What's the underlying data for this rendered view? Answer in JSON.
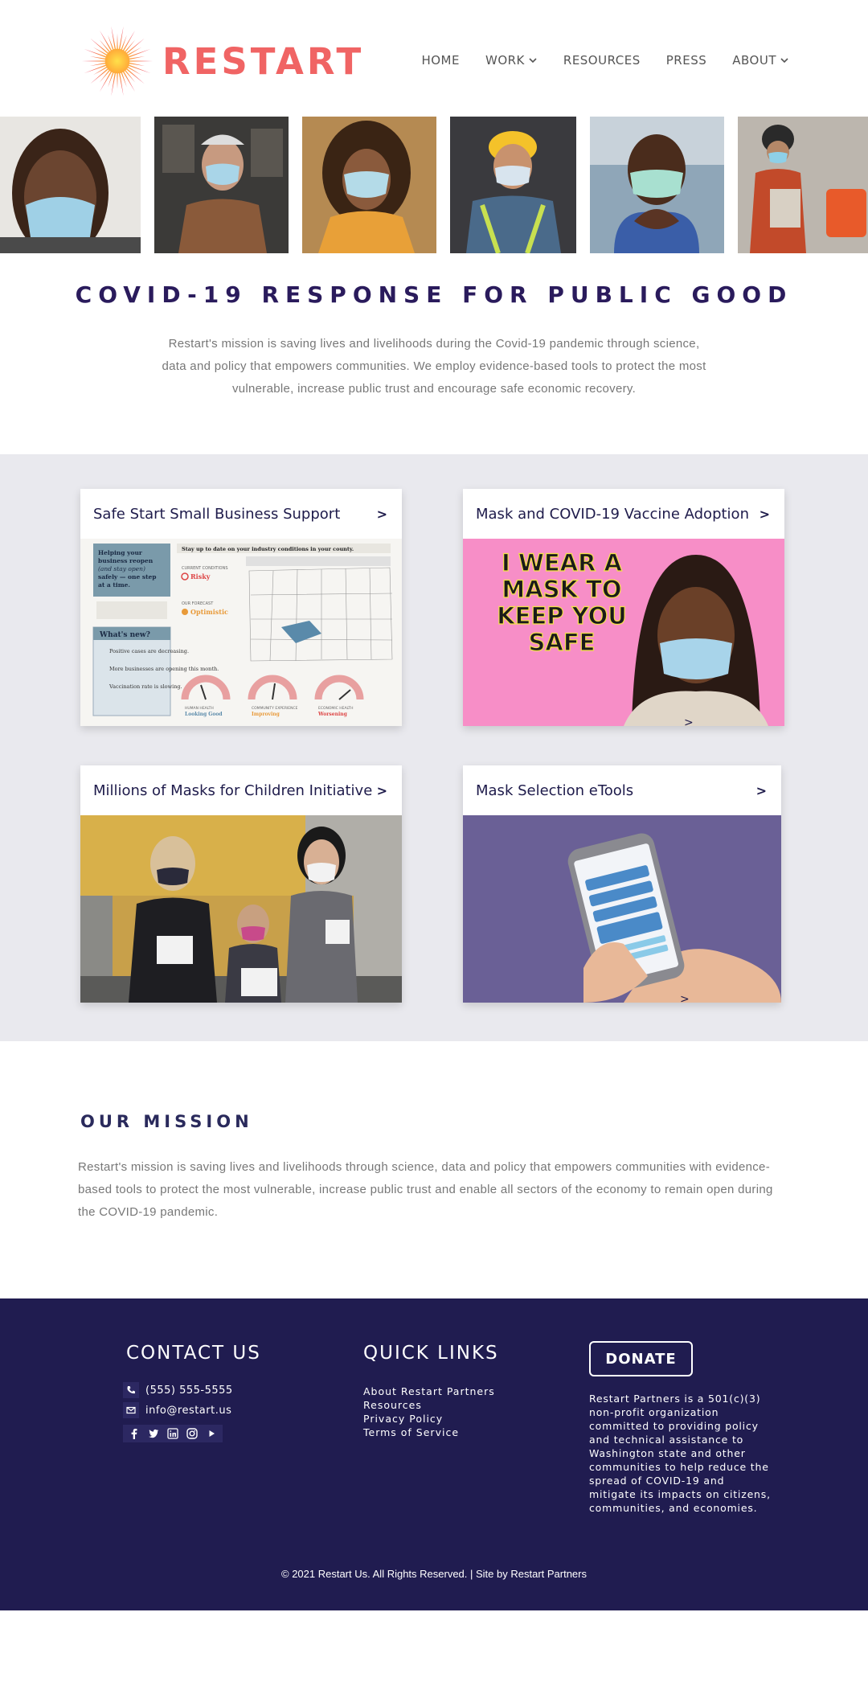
{
  "brand": {
    "name": "RESTART",
    "color": "#f06464"
  },
  "nav": {
    "items": [
      {
        "label": "HOME",
        "dropdown": false
      },
      {
        "label": "WORK",
        "dropdown": true
      },
      {
        "label": "RESOURCES",
        "dropdown": false
      },
      {
        "label": "PRESS",
        "dropdown": false
      },
      {
        "label": "ABOUT",
        "dropdown": true
      }
    ]
  },
  "intro": {
    "title": "COVID-19 RESPONSE FOR PUBLIC GOOD",
    "text": "Restart's mission is saving lives and livelihoods during the Covid-19 pandemic through science, data and policy that empowers communities. We employ evidence-based tools to protect the most vulnerable, increase public trust and encourage safe economic recovery."
  },
  "cards": [
    {
      "title": "Safe Start Small Business Support",
      "arrow": ">"
    },
    {
      "title": "Mask and COVID-19 Vaccine Adoption",
      "arrow": ">",
      "image_text": [
        "I WEAR A",
        "MASK TO",
        "KEEP YOU",
        "SAFE"
      ]
    },
    {
      "title": "Millions of Masks for Children Initiative",
      "arrow": ">"
    },
    {
      "title": "Mask Selection eTools",
      "arrow": ">"
    }
  ],
  "dashboard_preview": {
    "left_heading": [
      "Helping your",
      "business reopen",
      "(and stay open)",
      "safely — one step",
      "at a time."
    ],
    "whats_new": "What's new?",
    "bullets": [
      "Positive cases are decreasing.",
      "More businesses are opening this month.",
      "Vaccination rate is slowing."
    ],
    "top_bar": "Stay up to date on your industry conditions in your county.",
    "current_conditions_label": "CURRENT CONDITIONS",
    "current_conditions": "Risky",
    "forecast_label": "OUR FORECAST",
    "forecast": "Optimistic",
    "gauges": [
      {
        "label": "HUMAN HEALTH",
        "status": "Looking Good"
      },
      {
        "label": "COMMUNITY EXPERIENCE",
        "status": "Improving"
      },
      {
        "label": "ECONOMIC HEALTH",
        "status": "Worsening"
      }
    ]
  },
  "mission": {
    "title": "OUR MISSION",
    "text": "Restart's mission is saving lives and livelihoods through science, data and policy that empowers communities with evidence-based tools to protect the most vulnerable, increase public trust and enable all sectors of the economy to remain open during the COVID-19 pandemic."
  },
  "footer": {
    "contact_title": "CONTACT US",
    "phone": "(555) 555-5555",
    "email": "info@restart.us",
    "social_icons": [
      "facebook-icon",
      "twitter-icon",
      "linkedin-icon",
      "instagram-icon",
      "youtube-icon"
    ],
    "quick_links_title": "QUICK LINKS",
    "quick_links": [
      "About Restart Partners",
      "Resources",
      "Privacy Policy",
      "Terms of Service"
    ],
    "donate_label": "DONATE",
    "about": "Restart Partners is a 501(c)(3) non-profit organization committed to providing policy and technical assistance to Washington state and other communities to help reduce the spread of COVID-19 and mitigate its impacts on citizens, communities, and economies.",
    "copyright": "© 2021 Restart Us. All Rights Reserved. | Site by Restart Partners",
    "bg_color": "#201c50"
  }
}
